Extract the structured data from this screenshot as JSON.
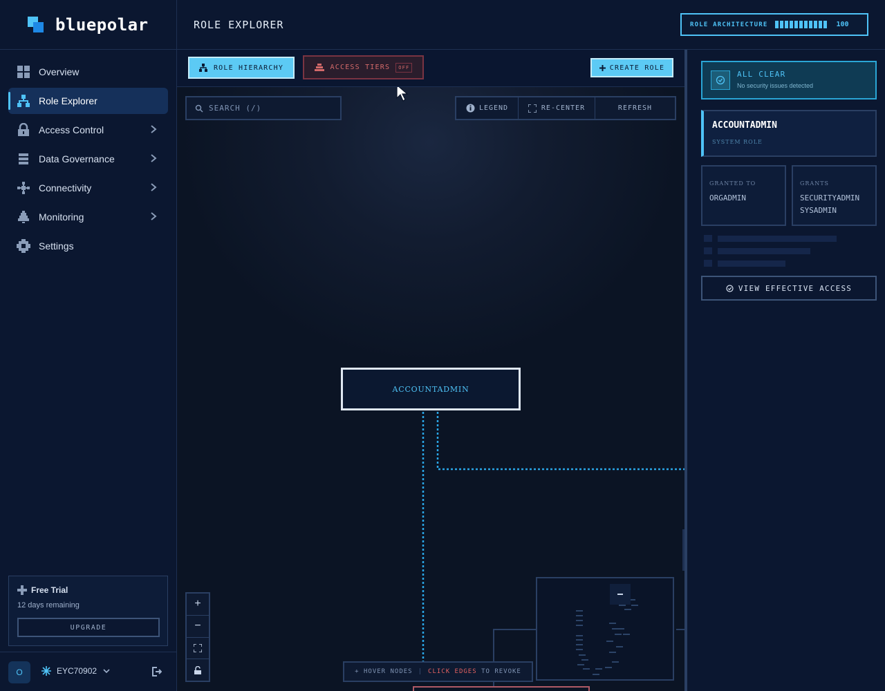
{
  "brand": {
    "name": "bluepolar"
  },
  "sidebar": {
    "items": [
      {
        "label": "Overview",
        "icon": "grid-icon"
      },
      {
        "label": "Role Explorer",
        "icon": "hierarchy-icon"
      },
      {
        "label": "Access Control",
        "icon": "lock-icon"
      },
      {
        "label": "Data Governance",
        "icon": "list-icon"
      },
      {
        "label": "Connectivity",
        "icon": "network-icon"
      },
      {
        "label": "Monitoring",
        "icon": "bell-icon"
      },
      {
        "label": "Settings",
        "icon": "gear-icon"
      }
    ],
    "active_item": "Role Explorer",
    "trial": {
      "title": "Free Trial",
      "remaining": "12 days remaining",
      "upgrade": "UPGRADE"
    },
    "user": {
      "initial": "O",
      "account": "EYC70902"
    }
  },
  "header": {
    "title": "ROLE EXPLORER",
    "score": {
      "label": "ROLE ARCHITECTURE",
      "value": "100",
      "fraction": 1.0
    }
  },
  "toolbar": {
    "hierarchy": "ROLE HIERARCHY",
    "access_tiers": "ACCESS TIERS",
    "access_tiers_state": "OFF",
    "create_role": "CREATE ROLE"
  },
  "canvas": {
    "search_placeholder": "SEARCH (/)",
    "controls": {
      "legend": "LEGEND",
      "recenter": "RE-CENTER",
      "refresh": "REFRESH"
    },
    "node": "ACCOUNTADMIN",
    "hint": {
      "hover": "HOVER NODES",
      "click": "CLICK EDGES",
      "revoke": "TO REVOKE"
    },
    "zoom": {
      "in": "+",
      "out": "−"
    }
  },
  "panel": {
    "status": {
      "title": "ALL CLEAR",
      "subtitle": "No security issues detected"
    },
    "role": {
      "name": "ACCOUNTADMIN",
      "type": "SYSTEM ROLE"
    },
    "granted_to": {
      "label": "GRANTED TO",
      "values": [
        "ORGADMIN"
      ]
    },
    "grants": {
      "label": "GRANTS",
      "values": [
        "SECURITYADMIN",
        "SYSADMIN"
      ]
    },
    "effective_access": "VIEW EFFECTIVE ACCESS"
  },
  "colors": {
    "accent": "#4fc3f7",
    "danger": "#e06060",
    "background": "#0a1428"
  }
}
